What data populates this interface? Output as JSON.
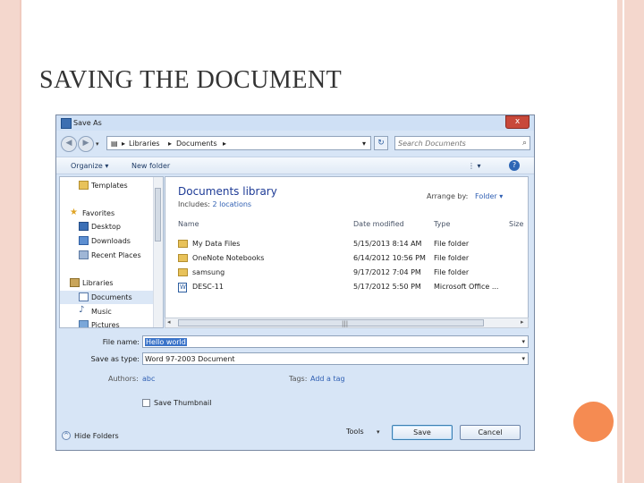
{
  "slide": {
    "title": "SAVING THE DOCUMENT",
    "colors": {
      "frame": "#f4d7cd",
      "accent_circle": "#f58b52"
    }
  },
  "dialog": {
    "title": "Save As",
    "close_glyph": "x",
    "address": {
      "crumbs": [
        "Libraries",
        "Documents"
      ],
      "separator": "▸",
      "dropdown_glyph": "▾"
    },
    "search": {
      "placeholder": "Search Documents",
      "icon": "search-icon"
    },
    "toolbar": {
      "organize": "Organize ▾",
      "new_folder": "New folder",
      "view_glyph": "⋮ ▾",
      "help": "?"
    },
    "nav": {
      "items": [
        {
          "label": "Templates",
          "icon": "folder-icon"
        },
        {
          "label": "Favorites",
          "icon": "star-icon"
        },
        {
          "label": "Desktop",
          "icon": "desktop-icon"
        },
        {
          "label": "Downloads",
          "icon": "downloads-icon"
        },
        {
          "label": "Recent Places",
          "icon": "recent-places-icon"
        },
        {
          "label": "Libraries",
          "icon": "libraries-icon"
        },
        {
          "label": "Documents",
          "icon": "documents-icon",
          "selected": true
        },
        {
          "label": "Music",
          "icon": "music-icon"
        },
        {
          "label": "Pictures",
          "icon": "pictures-icon"
        }
      ]
    },
    "library": {
      "title": "Documents library",
      "includes_label": "Includes:",
      "includes_value": "2 locations",
      "arrange_label": "Arrange by:",
      "arrange_value": "Folder ▾"
    },
    "columns": {
      "name": "Name",
      "date": "Date modified",
      "type": "Type",
      "size": "Size"
    },
    "files": [
      {
        "name": "My Data Files",
        "date": "5/15/2013 8:14 AM",
        "type": "File folder",
        "kind": "folder"
      },
      {
        "name": "OneNote Notebooks",
        "date": "6/14/2012 10:56 PM",
        "type": "File folder",
        "kind": "folder"
      },
      {
        "name": "samsung",
        "date": "9/17/2012 7:04 PM",
        "type": "File folder",
        "kind": "folder"
      },
      {
        "name": "DESC-11",
        "date": "5/17/2012 5:50 PM",
        "type": "Microsoft Office ...",
        "kind": "document"
      }
    ],
    "scroll": {
      "grip": "|||",
      "left": "◂",
      "right": "▸"
    },
    "form": {
      "file_name_label": "File name:",
      "file_name_value": "Hello world",
      "save_type_label": "Save as type:",
      "save_type_value": "Word 97-2003 Document",
      "authors_label": "Authors:",
      "authors_value": "abc",
      "tags_label": "Tags:",
      "tags_value": "Add a tag",
      "thumbnail_label": "Save Thumbnail",
      "thumbnail_checked": false
    },
    "footer": {
      "hide_folders": "Hide Folders",
      "tools": "Tools",
      "save": "Save",
      "cancel": "Cancel"
    }
  }
}
